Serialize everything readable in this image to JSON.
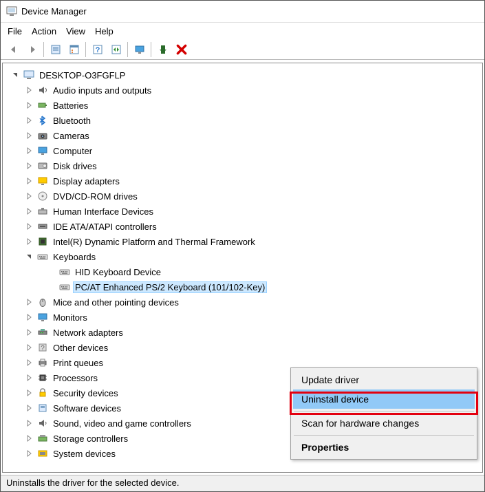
{
  "window": {
    "title": "Device Manager"
  },
  "menu": {
    "file": "File",
    "action": "Action",
    "view": "View",
    "help": "Help"
  },
  "toolbar": {
    "back": "back-arrow",
    "forward": "forward-arrow",
    "show_hidden": "show-hidden",
    "props": "properties",
    "help": "help",
    "scan": "scan-hardware",
    "monitor": "monitor",
    "install": "install-device",
    "uninstall": "uninstall-x"
  },
  "root": {
    "label": "DESKTOP-O3FGFLP"
  },
  "categories": [
    {
      "label": "Audio inputs and outputs",
      "icon": "audio"
    },
    {
      "label": "Batteries",
      "icon": "battery"
    },
    {
      "label": "Bluetooth",
      "icon": "bluetooth"
    },
    {
      "label": "Cameras",
      "icon": "camera"
    },
    {
      "label": "Computer",
      "icon": "computer"
    },
    {
      "label": "Disk drives",
      "icon": "disk"
    },
    {
      "label": "Display adapters",
      "icon": "display"
    },
    {
      "label": "DVD/CD-ROM drives",
      "icon": "dvd"
    },
    {
      "label": "Human Interface Devices",
      "icon": "hid"
    },
    {
      "label": "IDE ATA/ATAPI controllers",
      "icon": "ide"
    },
    {
      "label": "Intel(R) Dynamic Platform and Thermal Framework",
      "icon": "thermal"
    },
    {
      "label": "Keyboards",
      "icon": "keyboard",
      "expanded": true,
      "children": [
        {
          "label": "HID Keyboard Device",
          "icon": "keyboard"
        },
        {
          "label": "PC/AT Enhanced PS/2 Keyboard (101/102-Key)",
          "icon": "keyboard",
          "selected": true
        }
      ]
    },
    {
      "label": "Mice and other pointing devices",
      "icon": "mouse"
    },
    {
      "label": "Monitors",
      "icon": "monitor"
    },
    {
      "label": "Network adapters",
      "icon": "network"
    },
    {
      "label": "Other devices",
      "icon": "other"
    },
    {
      "label": "Print queues",
      "icon": "print"
    },
    {
      "label": "Processors",
      "icon": "cpu"
    },
    {
      "label": "Security devices",
      "icon": "security"
    },
    {
      "label": "Software devices",
      "icon": "software"
    },
    {
      "label": "Sound, video and game controllers",
      "icon": "sound"
    },
    {
      "label": "Storage controllers",
      "icon": "storage"
    },
    {
      "label": "System devices",
      "icon": "system"
    }
  ],
  "context_menu": {
    "update": "Update driver",
    "uninstall": "Uninstall device",
    "scan": "Scan for hardware changes",
    "properties": "Properties"
  },
  "status": "Uninstalls the driver for the selected device."
}
